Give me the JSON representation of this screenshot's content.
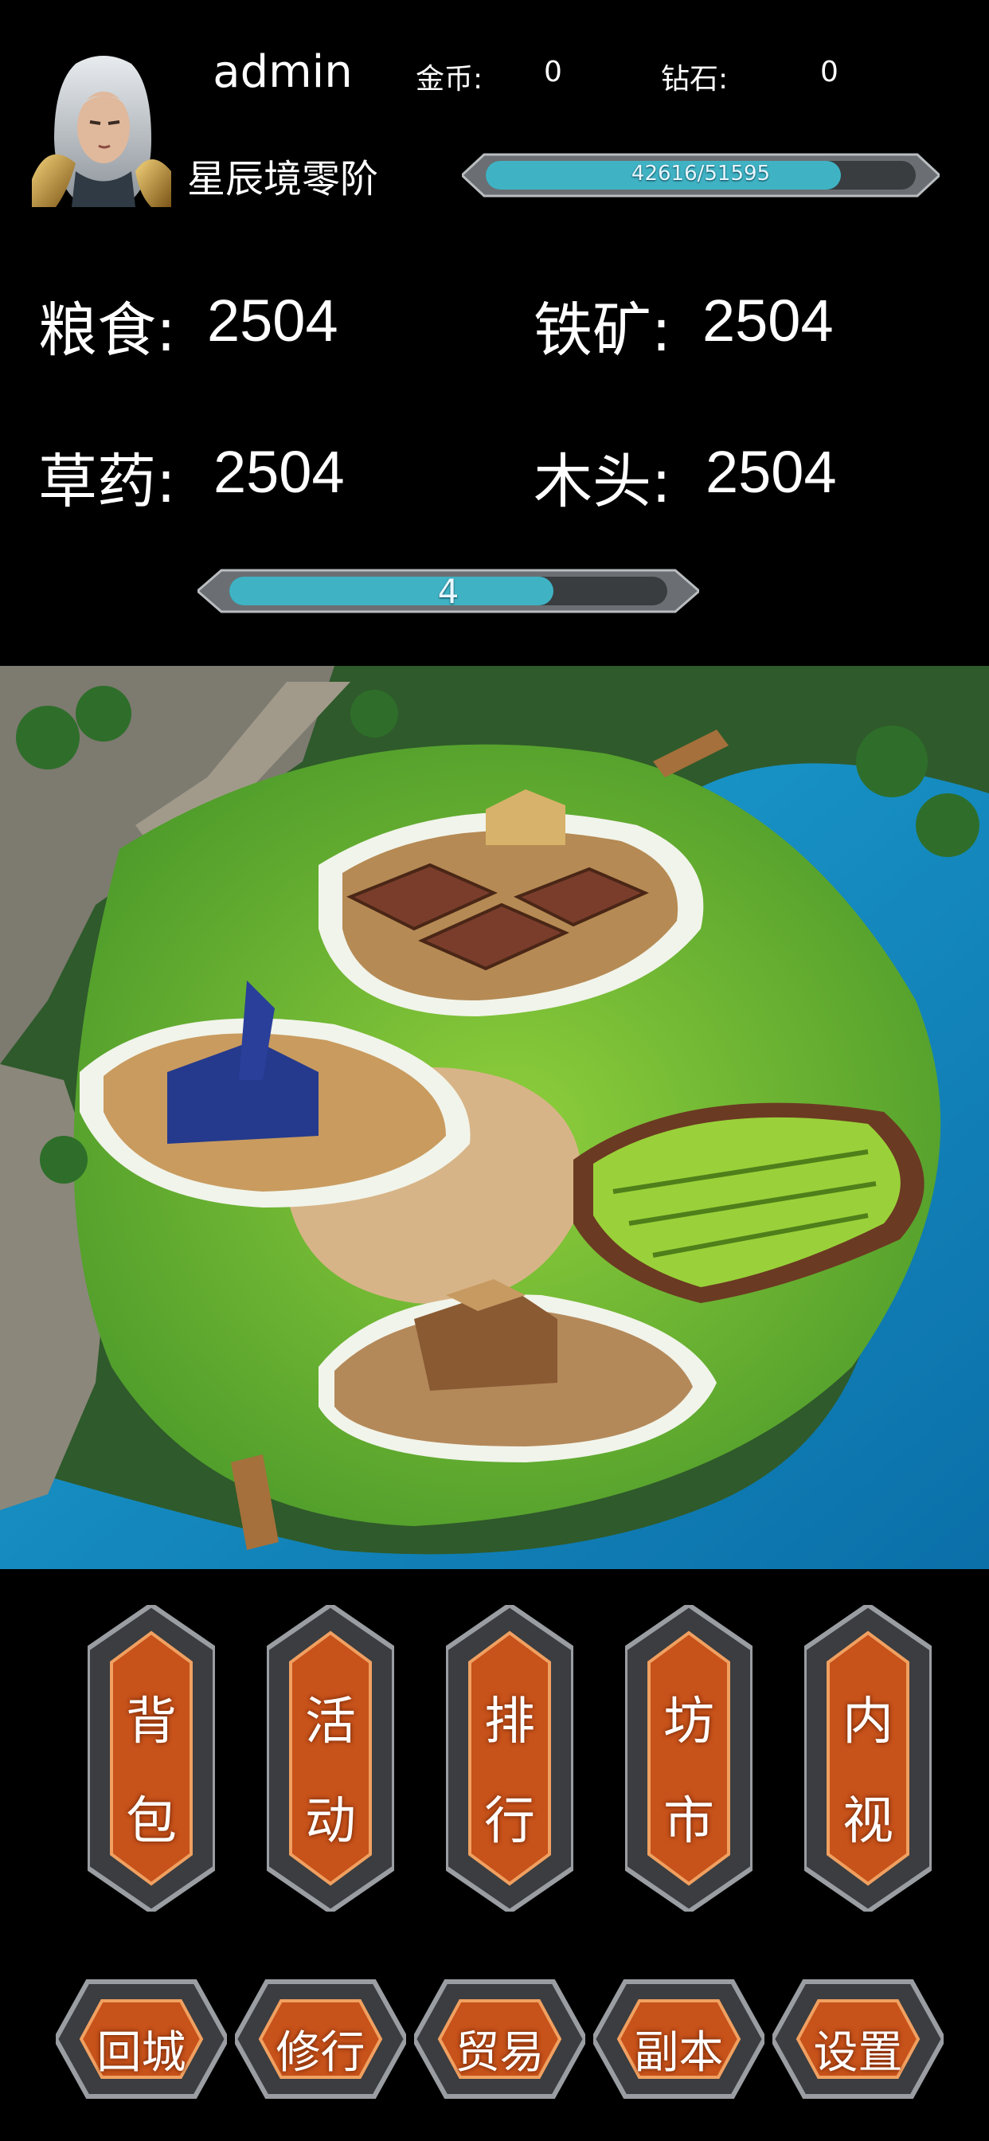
{
  "player": {
    "name": "admin",
    "rank": "星辰境零阶",
    "avatar_icon": "hero-portrait-icon",
    "exp": {
      "label": "42616/51595",
      "fraction": 0.826
    }
  },
  "currency": {
    "gold_label": "金币:",
    "gold_value": "0",
    "diamond_label": "钻石:",
    "diamond_value": "0"
  },
  "resources": {
    "food_label": "粮食:",
    "food_value": "2504",
    "iron_label": "铁矿:",
    "iron_value": "2504",
    "herb_label": "草药:",
    "herb_value": "2504",
    "wood_label": "木头:",
    "wood_value": "2504"
  },
  "level_bar": {
    "label": "4",
    "fraction": 0.74
  },
  "map": {
    "icon": "territory-map-icon"
  },
  "menu": {
    "bag": [
      "背",
      "包"
    ],
    "activity": [
      "活",
      "动"
    ],
    "ranking": [
      "排",
      "行"
    ],
    "market": [
      "坊",
      "市"
    ],
    "inner": [
      "内",
      "视"
    ]
  },
  "bottom_nav": {
    "return_city": "回城",
    "cultivate": "修行",
    "trade": "贸易",
    "dungeon": "副本",
    "settings": "设置"
  },
  "colors": {
    "bar_fill": "#3fb3c4",
    "button_orange": "#c7521a",
    "frame_metal": "#8a8a8a"
  }
}
